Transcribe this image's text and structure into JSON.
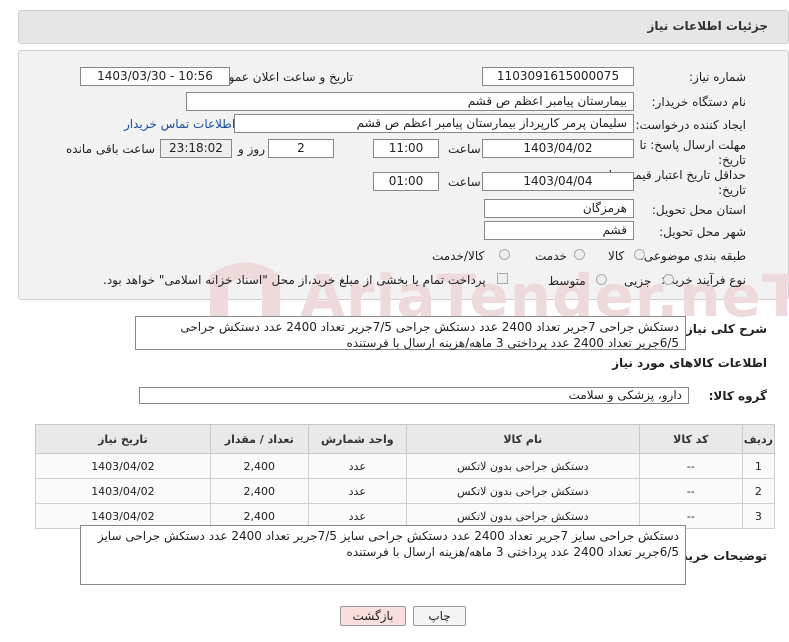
{
  "header": {
    "title": "جزئیات اطلاعات نیاز"
  },
  "fields": {
    "need_number_label": "شماره نیاز:",
    "need_number": "1103091615000075",
    "announce_label": "تاریخ و ساعت اعلان عمومی:",
    "announce_value": "1403/03/30 - 10:56",
    "buyer_org_label": "نام دستگاه خریدار:",
    "buyer_org": "بیمارستان پیامبر اعظم  ص  قشم",
    "creator_label": "ایجاد کننده درخواست:",
    "creator": "سلیمان پرمر کارپرداز بیمارستان پیامبر اعظم  ص  قشم",
    "contact_link": "اطلاعات تماس خریدار",
    "reply_deadline_label": "مهلت ارسال پاسخ: تا",
    "reply_deadline_label2": "تاریخ:",
    "reply_date": "1403/04/02",
    "time_label": "ساعت",
    "reply_time": "11:00",
    "days_value": "2",
    "days_label": "روز و",
    "remaining_time": "23:18:02",
    "remaining_label": "ساعت باقی مانده",
    "price_validity_label": "حداقل تاریخ اعتبار قیمت: تا",
    "price_validity_label2": "تاریخ:",
    "validity_date": "1403/04/04",
    "validity_time": "01:00",
    "province_label": "استان محل تحویل:",
    "province": "هرمزگان",
    "city_label": "شهر محل تحویل:",
    "city": "قشم",
    "category_label": "طبقه بندی موضوعی:",
    "category_options": [
      "کالا",
      "خدمت",
      "کالا/خدمت"
    ],
    "process_label": "نوع فرآیند خرید :",
    "process_options": [
      "جزیی",
      "متوسط"
    ],
    "payment_note": "پرداخت تمام یا بخشی از مبلغ خرید،از محل \"اسناد خزانه اسلامی\" خواهد بود."
  },
  "description": {
    "label": "شرح کلی نیاز:",
    "text": "دستکش جراحی 7جریر تعداد 2400 عدد دستکش جراحی  7/5جریر تعداد 2400 عدد دستکش جراحی  6/5جریر تعداد 2400 عدد پرداختی 3 ماهه/هزینه ارسال با فرستنده"
  },
  "goods_info": {
    "title": "اطلاعات کالاهای مورد نیاز",
    "group_label": "گروه کالا:",
    "group_value": "دارو، پزشکی و سلامت"
  },
  "table": {
    "headers": [
      "ردیف",
      "کد کالا",
      "نام کالا",
      "واحد شمارش",
      "تعداد / مقدار",
      "تاریخ نیاز"
    ],
    "rows": [
      [
        "1",
        "--",
        "دستکش جراحی بدون لاتکس",
        "عدد",
        "2,400",
        "1403/04/02"
      ],
      [
        "2",
        "--",
        "دستکش جراحی بدون لاتکس",
        "عدد",
        "2,400",
        "1403/04/02"
      ],
      [
        "3",
        "--",
        "دستکش جراحی بدون لاتکس",
        "عدد",
        "2,400",
        "1403/04/02"
      ]
    ]
  },
  "buyer_notes": {
    "label": "توضیحات خریدار:",
    "text": "دستکش جراحی سایز 7جریر تعداد 2400 عدد دستکش جراحی سایز 7/5جریر تعداد 2400 عدد دستکش جراحی سایز 6/5جریر تعداد 2400 عدد پرداختی 3 ماهه/هزینه ارسال با فرستنده"
  },
  "buttons": {
    "print": "چاپ",
    "back": "بازگشت"
  },
  "watermark": "AriaTender.neT",
  "colors": {
    "link": "#1a4fa0",
    "back_button": "#f9dede",
    "header_bg": "#e6e6e6",
    "panel_bg": "#f2f2f2"
  }
}
